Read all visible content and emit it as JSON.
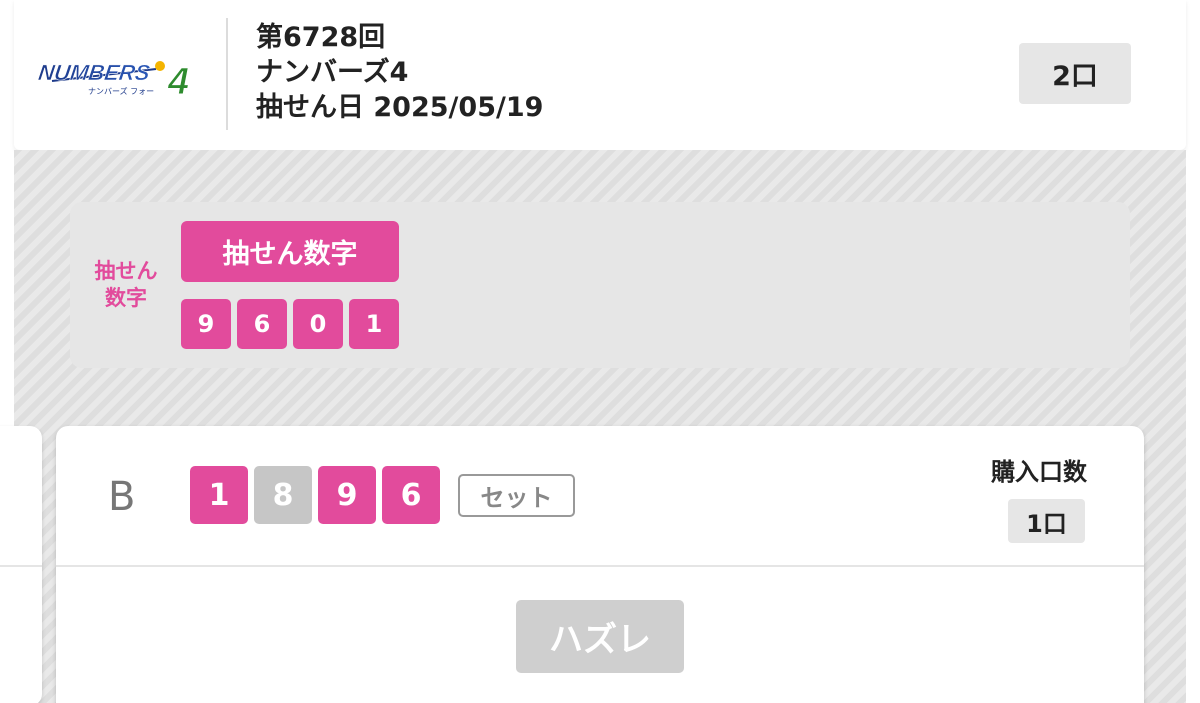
{
  "header": {
    "logo_text": "NUMBERS4",
    "logo_subtext": "ナンバーズ フォー",
    "round": "第6728回",
    "game_name": "ナンバーズ4",
    "draw_date": "抽せん日 2025/05/19",
    "ticket_count": "2口"
  },
  "draw": {
    "side_label_line1": "抽せん",
    "side_label_line2": "数字",
    "button_label": "抽せん数字",
    "digits": [
      "9",
      "6",
      "0",
      "1"
    ]
  },
  "ticket": {
    "set_label": "B",
    "digits": [
      "1",
      "8",
      "9",
      "6"
    ],
    "digit_hits": [
      true,
      false,
      true,
      true
    ],
    "type_badge": "セット",
    "purchase_label": "購入口数",
    "purchase_count": "1口",
    "result_label": "ハズレ"
  },
  "colors": {
    "accent": "#e24b9c",
    "miss": "#c6c6c6",
    "result_disabled": "#cfcfcf"
  }
}
